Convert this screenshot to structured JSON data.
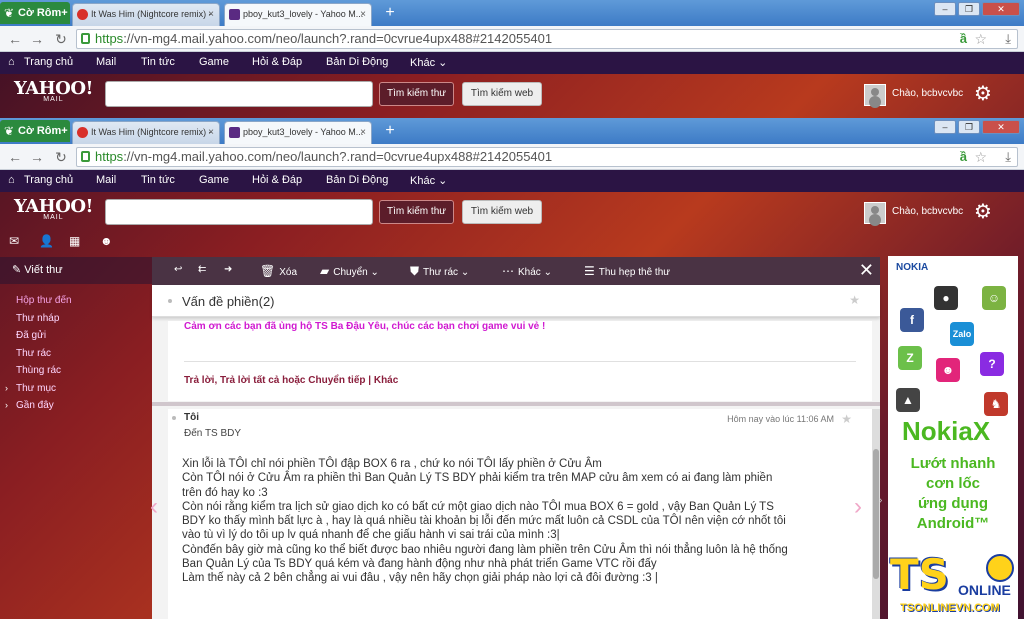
{
  "browser": {
    "brand_tab": "Cờ Rôm+",
    "tabs": [
      {
        "label": "It Was Him (Nightcore remix) - ",
        "favicon_color": "#d8302a"
      },
      {
        "label": "pboy_kut3_lovely - Yahoo M...",
        "favicon_color": "#5a2a82"
      }
    ],
    "url_scheme": "https",
    "url_rest": "://vn-mg4.mail.yahoo.com/neo/launch?.rand=0cvrue4upx488#2142055401"
  },
  "yahoo_nav": {
    "items": [
      "Trang chủ",
      "Mail",
      "Tin tức",
      "Game",
      "Hỏi & Đáp",
      "Bản Di Động",
      "Khác ⌄"
    ]
  },
  "yahoo_header": {
    "logo": "YAHOO!",
    "logo_sub": "MAIL",
    "search_mail_button": "Tìm kiếm thư",
    "search_web_button": "Tìm kiếm web",
    "greeting": "Chào, bcbvcvbc"
  },
  "sidebar": {
    "compose_label": "Viết thư",
    "folders": [
      "Hộp thư đến",
      "Thư nháp",
      "Đã gửi",
      "Thư rác",
      "Thùng rác",
      "Thư mục",
      "Gần đây"
    ]
  },
  "message_toolbar": {
    "delete": "Xóa",
    "move": "Chuyển",
    "spam": "Thư rác",
    "more": "Khác",
    "collapse": "Thu hẹp thê thư"
  },
  "conversation": {
    "subject": "Vấn đề phiền(2)",
    "message1": {
      "thanks_line": "Cảm ơn các bạn đã ủng hộ TS Ba Đậu Yêu, chúc các bạn chơi game vui vẻ !",
      "actions": "Trả lời, Trả lời tất cả hoặc Chuyển tiếp | Khác"
    },
    "message2": {
      "from": "Tôi",
      "to": "Đến  TS BDY",
      "time": "Hôm nay vào lúc 11:06 AM",
      "body": [
        "Xin lỗi là TÔI chỉ nói phiền TÔI đập BOX 6 ra , chứ ko nói TÔI lấy phiền ở Cửu Âm",
        "Còn TÔI nói ở Cửu Âm ra phiền thì Ban Quản Lý TS BDY phải kiểm tra trên MAP cửu âm xem có ai đang làm phiền",
        "trên đó hay ko :3",
        "Còn nói rằng kiểm tra lịch sử giao dịch ko có bất cứ một giao dịch nào TÔI mua BOX 6 = gold , vậy Ban Quản Lý TS",
        "BDY ko thấy mình bất lực à , hay là quá nhiều tài khoản bị lỗi đến mức mất luôn cả CSDL của TÔI nên viện cớ nhốt tôi",
        "vào tù vì lý do tôi up lv quá nhanh để che giấu hành vi sai trái của mình :3|",
        "Cònđến bây giờ mà cũng ko thể biết được bao nhiêu người đang làm phiền trên Cửu Âm thì nói thẳng luôn là hệ thống",
        "Ban Quản Lý của Ts BDY quá kém và đang hành động như nhà phát triển Game VTC rồi đấy",
        "Làm thế này cả 2 bên chẳng ai vui đâu , vậy nên hãy chọn giải pháp nào lợi cả đôi đường :3 |"
      ]
    }
  },
  "ad": {
    "brand": "NOKIA",
    "product": "NokiaX",
    "slogan": [
      "Lướt nhanh",
      "cơn lốc",
      "ứng dụng",
      "Android™"
    ]
  },
  "ts_logo": {
    "ts": "TS",
    "online": "ONLINE",
    "url": "TSONLINEVN.COM"
  },
  "colors": {
    "yahoo_bar": "#2b1444",
    "toolbar": "#4a3344",
    "accent_pink": "#d01ad0",
    "nokia_green": "#4bb821"
  }
}
